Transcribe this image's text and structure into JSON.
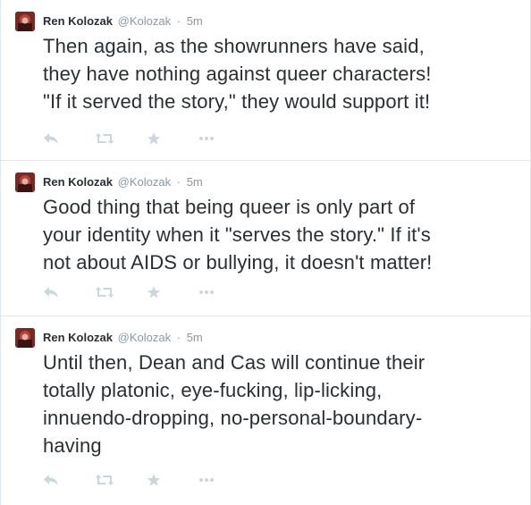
{
  "tweets": [
    {
      "fullname": "Ren Kolozak",
      "username": "@Kolozak",
      "separator": "·",
      "time": "5m",
      "text": "Then again, as the showrunners have said,\nthey have nothing against queer characters!\n\"If it served the story,\" they would support it!"
    },
    {
      "fullname": "Ren Kolozak",
      "username": "@Kolozak",
      "separator": "·",
      "time": "5m",
      "text": "Good thing that being queer is only part of\nyour identity when it \"serves the story.\" If it's\nnot about AIDS or bullying, it doesn't matter!"
    },
    {
      "fullname": "Ren Kolozak",
      "username": "@Kolozak",
      "separator": "·",
      "time": "5m",
      "text": "Until then, Dean and Cas will continue their\ntotally platonic, eye-fucking, lip-licking,\ninnuendo-dropping, no-personal-boundary-\nhaving"
    }
  ],
  "actions": [
    "reply-icon",
    "retweet-icon",
    "favorite-icon",
    "more-icon"
  ],
  "colors": {
    "text": "#292f33",
    "meta": "#8899a6",
    "action_icon": "#ccd6dd",
    "divider": "#e1e8ed"
  }
}
